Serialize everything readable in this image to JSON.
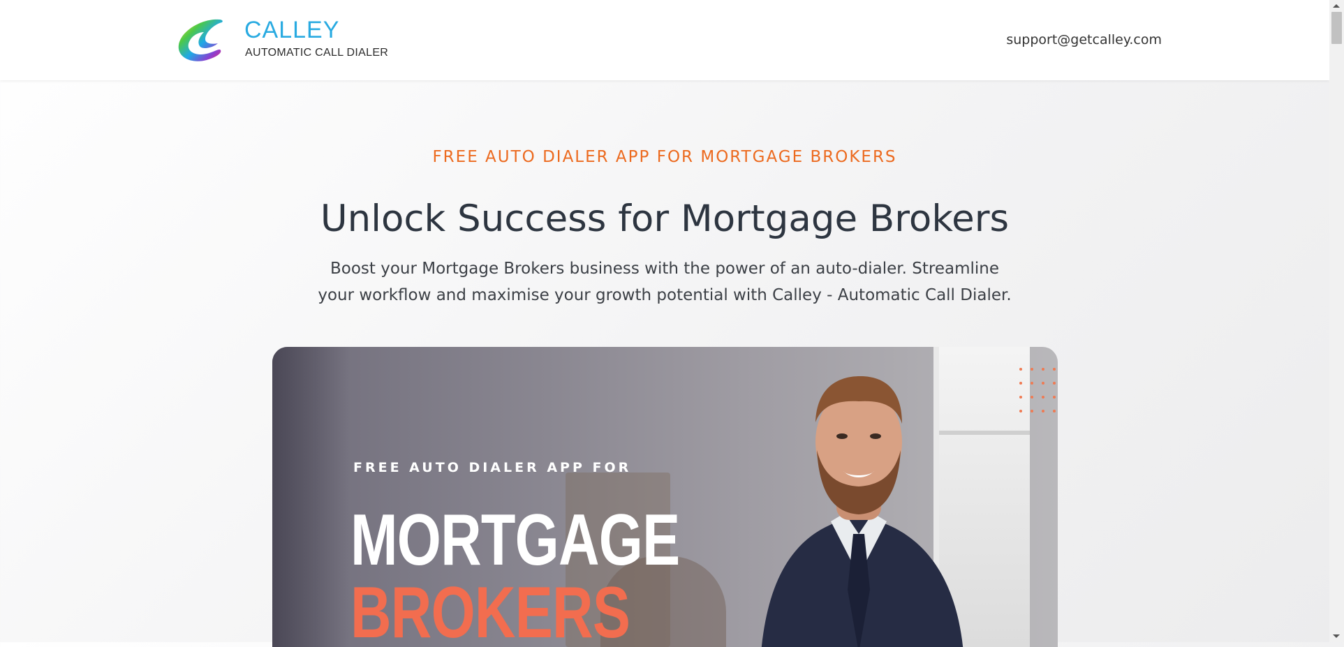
{
  "header": {
    "brand_name": "CALLEY",
    "brand_tagline": "AUTOMATIC CALL DIALER",
    "support_email": "support@getcalley.com"
  },
  "main": {
    "eyebrow": "FREE AUTO DIALER APP FOR MORTGAGE BROKERS",
    "headline": "Unlock Success for Mortgage Brokers",
    "subtext": "Boost your Mortgage Brokers business with the power of an auto-dialer. Streamline your workflow and maximise your growth potential with Calley - Automatic Call Dialer."
  },
  "hero": {
    "pre_title": "FREE AUTO DIALER APP FOR",
    "title_line1": "MORTGAGE",
    "title_line2": "BROKERS"
  },
  "colors": {
    "accent_orange": "#ec6a1f",
    "brand_blue": "#28aae1",
    "headline_text": "#2d3540",
    "hero_coral": "#f26d4f"
  },
  "icons": {
    "logo": "calley-swirl-logo"
  }
}
